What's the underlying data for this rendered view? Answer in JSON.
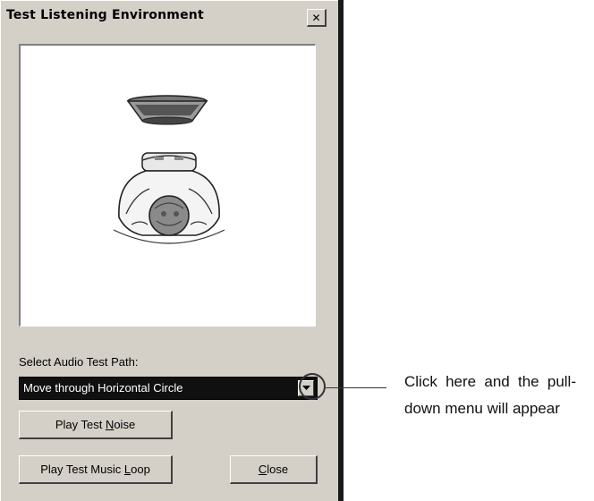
{
  "window": {
    "title": "Test Listening Environment",
    "close_glyph": "✕"
  },
  "preview": {
    "description_icon": "speakers-and-listener-illustration"
  },
  "path": {
    "label": "Select Audio Test Path:",
    "selected_value": "Move through Horizontal Circle"
  },
  "buttons": {
    "play_noise_prefix": "Play Test ",
    "play_noise_mnemonic": "N",
    "play_noise_suffix": "oise",
    "play_music_prefix": "Play Test Music ",
    "play_music_mnemonic": "L",
    "play_music_suffix": "oop",
    "close_mnemonic": "C",
    "close_suffix": "lose"
  },
  "annotation": {
    "text": "Click here and the pull-down menu will appear"
  },
  "colors": {
    "dialog_bg": "#d4d0c8",
    "select_bg": "#101010",
    "select_text": "#ffffff"
  }
}
